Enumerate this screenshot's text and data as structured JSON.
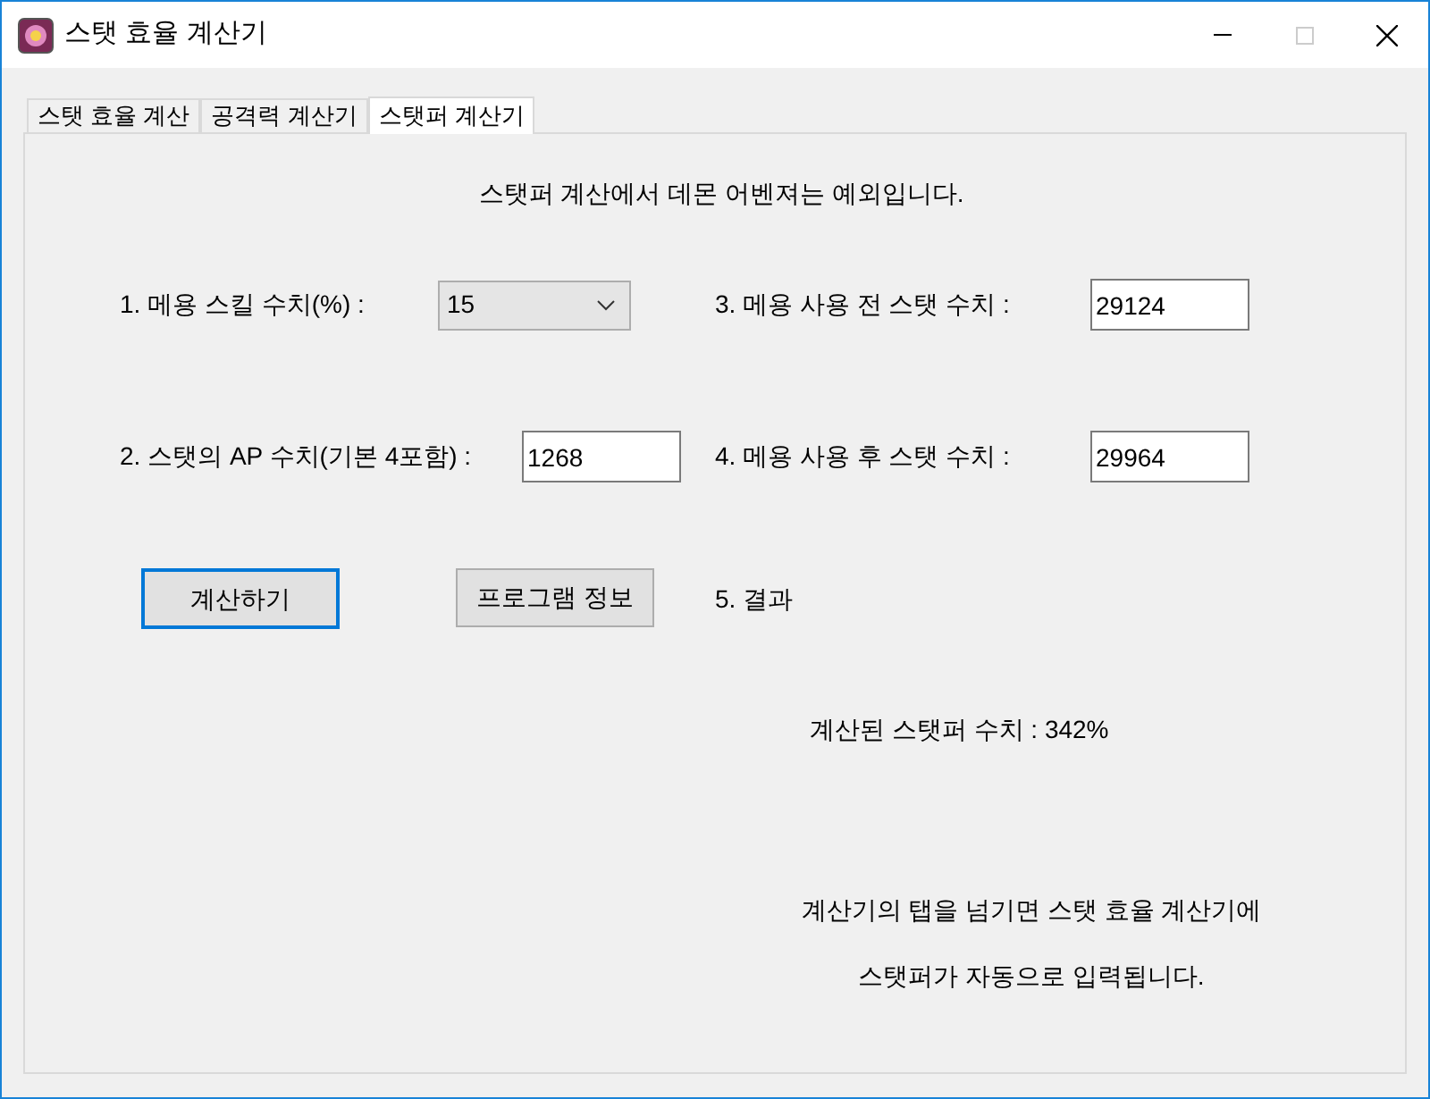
{
  "window": {
    "title": "스탯 효율 계산기"
  },
  "tabs": [
    {
      "label": "스탯 효율 계산",
      "selected": false
    },
    {
      "label": "공격력 계산기",
      "selected": false
    },
    {
      "label": "스탯퍼 계산기",
      "selected": true
    }
  ],
  "notice": "스탯퍼 계산에서 데몬 어벤져는 예외입니다.",
  "rows": [
    [
      {
        "label": "1. 메용 스킬 수치(%) :",
        "kind": "dropdown",
        "value": "15"
      },
      {
        "label": "3. 메용 사용 전 스탯 수치 :",
        "kind": "textbox",
        "value": "29124"
      }
    ],
    [
      {
        "label": "2. 스탯의 AP 수치(기본 4포함) :",
        "kind": "textbox",
        "value": "1268"
      },
      {
        "label": "4. 메용 사용 후 스탯 수치 :",
        "kind": "textbox",
        "value": "29964"
      }
    ]
  ],
  "buttons": [
    {
      "label": "계산하기",
      "focused": true
    },
    {
      "label": "프로그램 정보",
      "focused": false
    }
  ],
  "result_heading": "5. 결과",
  "result": "계산된 스탯퍼 수치 : 342%",
  "footer": [
    "계산기의 탭을 넘기면 스탯 효율 계산기에",
    "스탯퍼가 자동으로 입력됩니다."
  ]
}
